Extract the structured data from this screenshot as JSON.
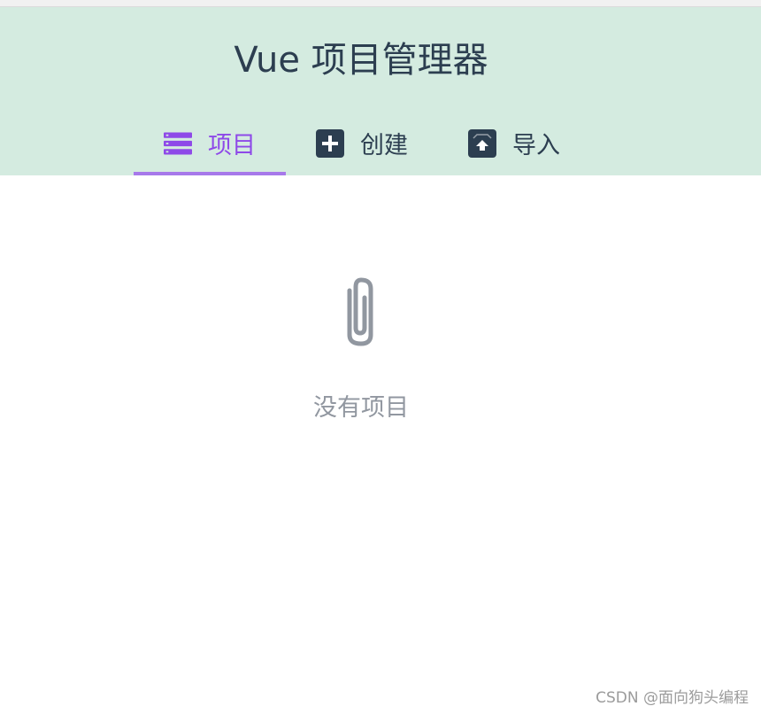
{
  "header": {
    "title": "Vue 项目管理器",
    "background": "#d4ebe0"
  },
  "tabs": [
    {
      "label": "项目",
      "icon": "list-icon",
      "active": true
    },
    {
      "label": "创建",
      "icon": "plus-square-icon",
      "active": false
    },
    {
      "label": "导入",
      "icon": "import-box-icon",
      "active": false
    }
  ],
  "colors": {
    "accent": "#8e49e8",
    "accent_underline": "#a779ea",
    "text_dark": "#2c3e50",
    "muted": "#9197a0"
  },
  "empty_state": {
    "icon": "paperclip-icon",
    "text": "没有项目"
  },
  "watermark": {
    "text": "CSDN @面向狗头编程"
  }
}
